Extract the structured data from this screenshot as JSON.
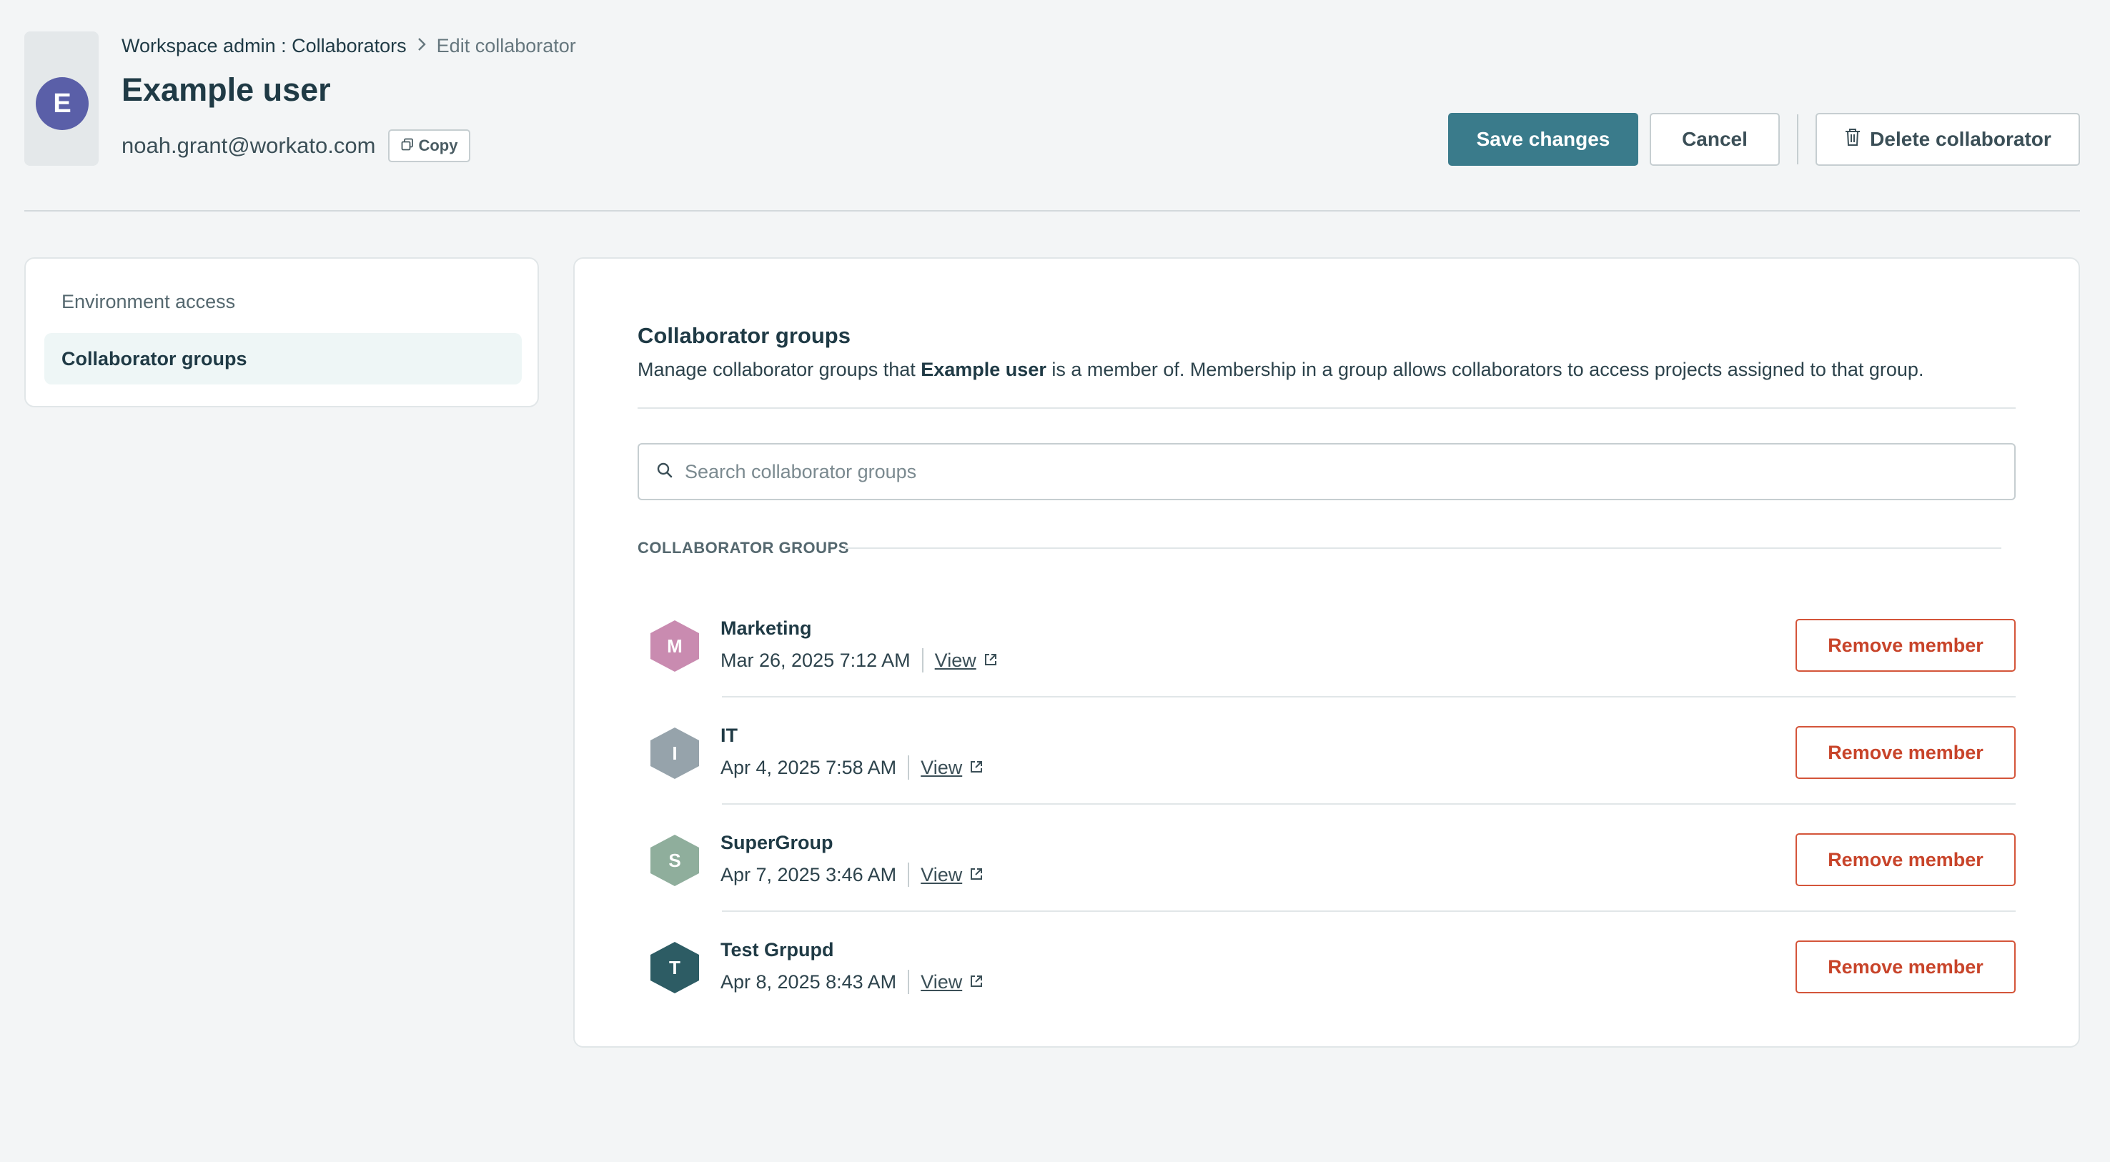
{
  "header": {
    "avatar_letter": "E",
    "breadcrumb": {
      "parent": "Workspace admin : Collaborators",
      "current": "Edit collaborator"
    },
    "user_name": "Example user",
    "email": "noah.grant@workato.com",
    "copy_label": "Copy",
    "save_label": "Save changes",
    "cancel_label": "Cancel",
    "delete_label": "Delete collaborator"
  },
  "sidebar": {
    "items": [
      {
        "label": "Environment access",
        "active": false
      },
      {
        "label": "Collaborator groups",
        "active": true
      }
    ]
  },
  "panel": {
    "title": "Collaborator groups",
    "desc_prefix": "Manage collaborator groups that ",
    "desc_user": "Example user",
    "desc_suffix": " is a member of. Membership in a group allows collaborators to access projects assigned to that group.",
    "search_placeholder": "Search collaborator groups",
    "section_label": "COLLABORATOR GROUPS",
    "view_label": "View",
    "remove_label": "Remove member",
    "groups": [
      {
        "letter": "M",
        "name": "Marketing",
        "date": "Mar 26, 2025 7:12 AM",
        "color": "#c98bb0"
      },
      {
        "letter": "I",
        "name": "IT",
        "date": "Apr 4, 2025 7:58 AM",
        "color": "#96a3ab"
      },
      {
        "letter": "S",
        "name": "SuperGroup",
        "date": "Apr 7, 2025 3:46 AM",
        "color": "#8fae9c"
      },
      {
        "letter": "T",
        "name": "Test Grpupd",
        "date": "Apr 8, 2025 8:43 AM",
        "color": "#2d5c64"
      }
    ]
  },
  "colors": {
    "accent": "#3a7b8b",
    "danger": "#c8442a",
    "avatar": "#5a5fa8"
  },
  "icons": [
    "copy-icon",
    "trash-icon",
    "chevron-right-icon",
    "search-icon",
    "external-link-icon"
  ]
}
